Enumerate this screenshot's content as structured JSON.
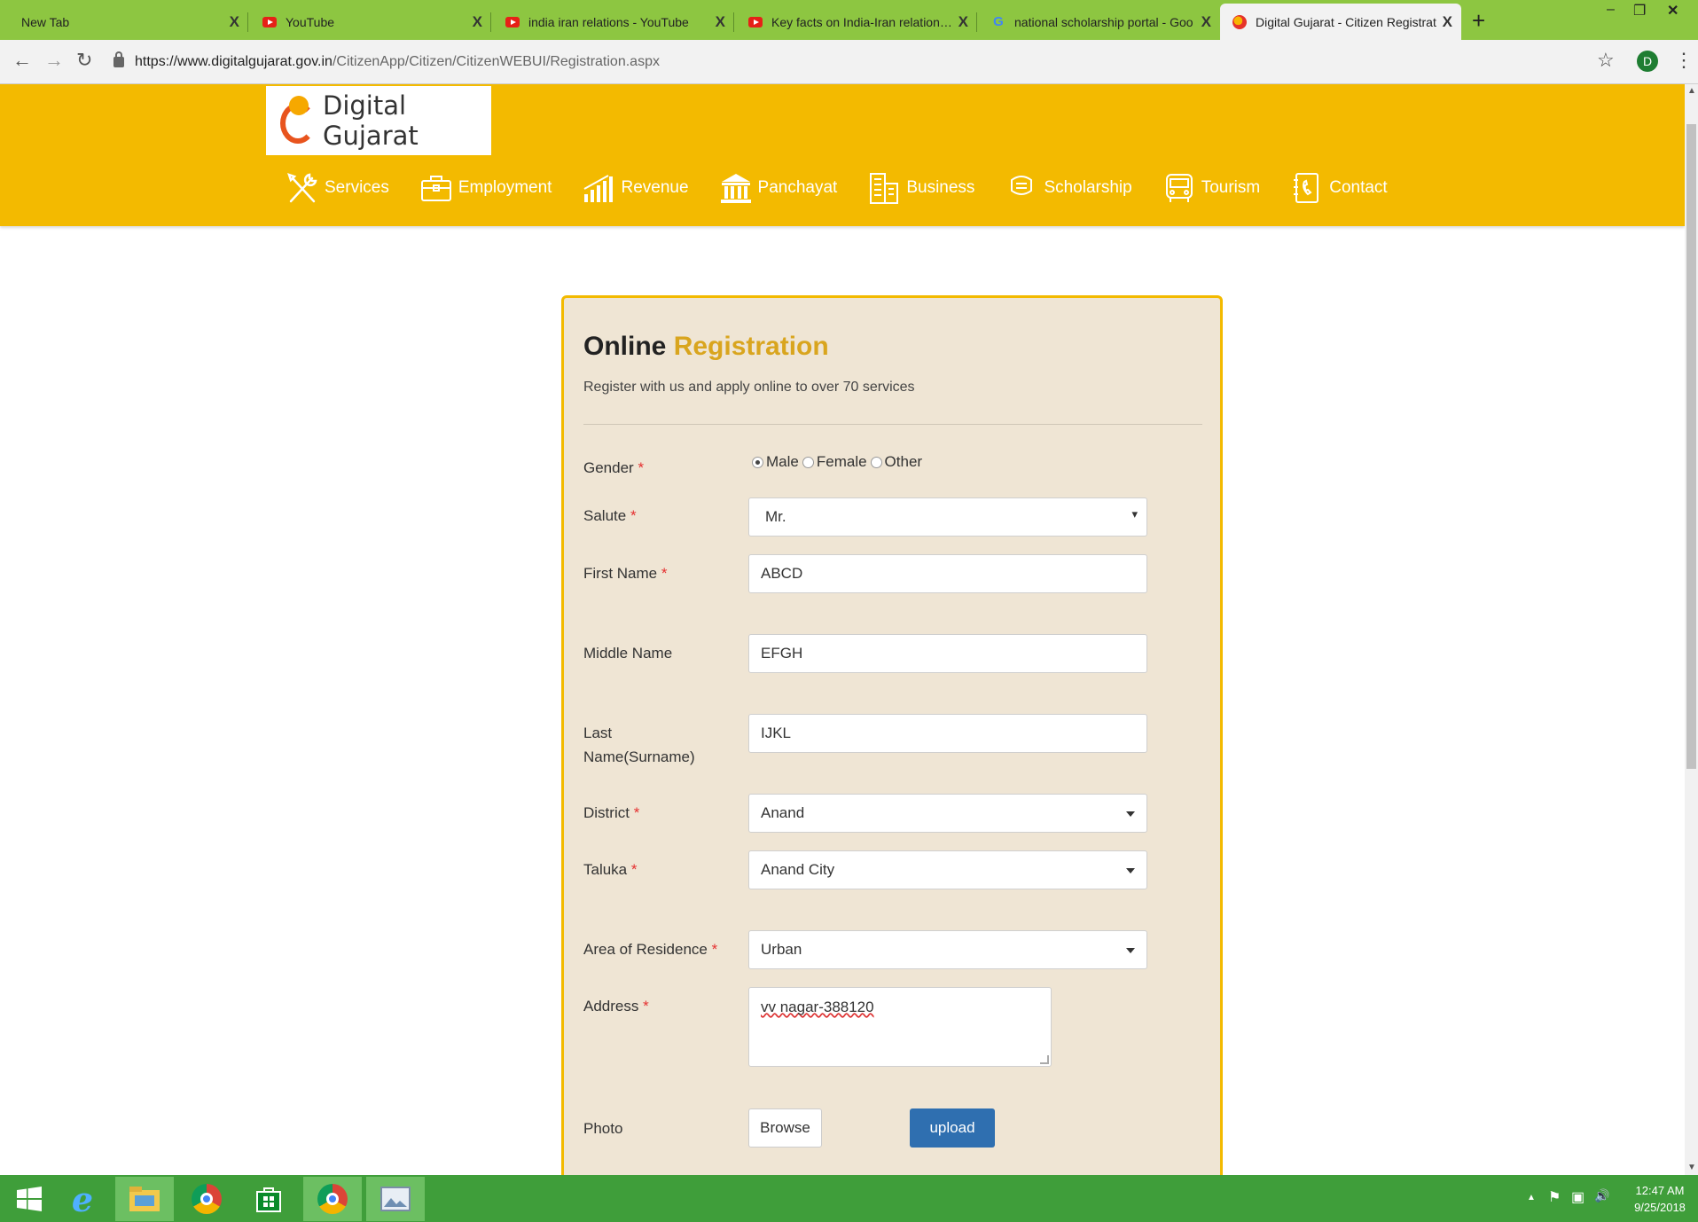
{
  "browser": {
    "tabs": [
      {
        "title": "New Tab",
        "favicon": "none"
      },
      {
        "title": "YouTube",
        "favicon": "youtube-icon"
      },
      {
        "title": "india iran relations - YouTube",
        "favicon": "youtube-icon"
      },
      {
        "title": "Key facts on India-Iran relations -",
        "favicon": "youtube-icon"
      },
      {
        "title": "national scholarship portal - Goo",
        "favicon": "google-icon"
      },
      {
        "title": "Digital Gujarat - Citizen Registrat",
        "favicon": "digital-gujarat-icon",
        "active": true
      }
    ],
    "close_glyph": "X",
    "new_tab_glyph": "+",
    "window_controls": {
      "minimize": "–",
      "restore": "❐",
      "close": "✕"
    },
    "nav": {
      "back": "←",
      "forward": "→",
      "reload": "↻"
    },
    "url_domain": "https://www.digitalgujarat.gov.in",
    "url_path": "/CitizenApp/Citizen/CitizenWEBUI/Registration.aspx",
    "bookmark_glyph": "☆",
    "profile_initial": "D",
    "menu_glyph": "⋮"
  },
  "site": {
    "logo_text": "Digital Gujarat",
    "nav": [
      {
        "label": "Services",
        "icon": "tools-icon"
      },
      {
        "label": "Employment",
        "icon": "briefcase-icon"
      },
      {
        "label": "Revenue",
        "icon": "bar-chart-icon"
      },
      {
        "label": "Panchayat",
        "icon": "government-building-icon"
      },
      {
        "label": "Business",
        "icon": "office-buildings-icon"
      },
      {
        "label": "Scholarship",
        "icon": "scholarship-icon"
      },
      {
        "label": "Tourism",
        "icon": "bus-icon"
      },
      {
        "label": "Contact",
        "icon": "phone-book-icon"
      }
    ],
    "colors": {
      "header": "#f3ba00",
      "accent": "#d9a51e",
      "upload": "#2f6fb0",
      "required": "#e53030"
    }
  },
  "form": {
    "title_part1": "Online",
    "title_part2": "Registration",
    "subtitle": "Register with us and apply online to over 70 services",
    "required_mark": "*",
    "gender": {
      "label": "Gender",
      "options": [
        "Male",
        "Female",
        "Other"
      ],
      "selected": "Male"
    },
    "salute": {
      "label": "Salute",
      "value": "Mr."
    },
    "first_name": {
      "label": "First Name",
      "value": "ABCD"
    },
    "middle_name": {
      "label": "Middle Name",
      "value": "EFGH"
    },
    "last_name": {
      "label_line1": "Last",
      "label_line2": "Name(Surname)",
      "value": "IJKL"
    },
    "district": {
      "label": "District",
      "value": "Anand"
    },
    "taluka": {
      "label": "Taluka",
      "value": "Anand City"
    },
    "area": {
      "label": "Area of Residence",
      "value": "Urban"
    },
    "address": {
      "label": "Address",
      "value": "vv nagar-388120"
    },
    "photo": {
      "label": "Photo",
      "browse": "Browse",
      "upload": "upload"
    }
  },
  "taskbar": {
    "apps": [
      "windows-start-icon",
      "internet-explorer-icon",
      "file-explorer-icon",
      "chrome-icon",
      "store-icon",
      "chrome-icon",
      "photo-viewer-icon"
    ],
    "tray": {
      "up": "▲",
      "flag": "⚑",
      "network": "▣",
      "volume": "🔊"
    },
    "time": "12:47 AM",
    "date": "9/25/2018"
  }
}
